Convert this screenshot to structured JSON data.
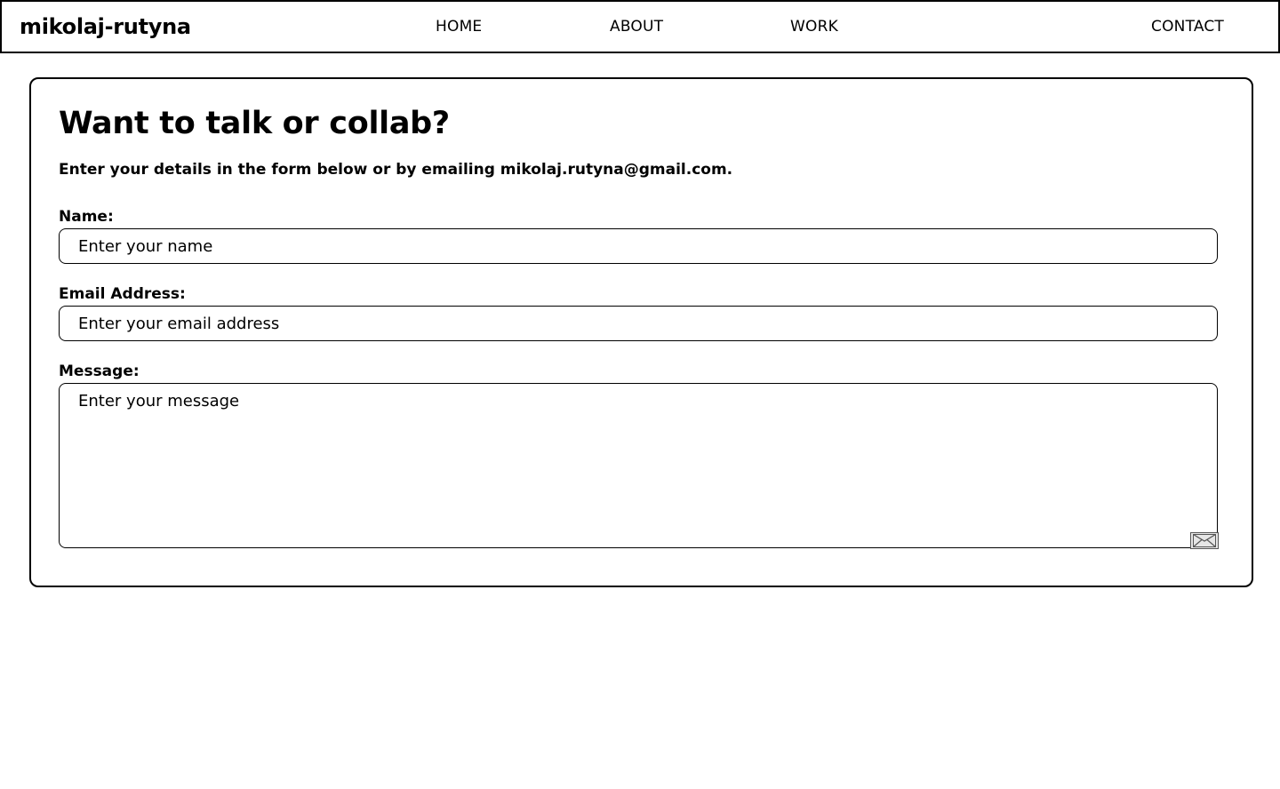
{
  "header": {
    "brand": "mikolaj-rutyna",
    "nav": {
      "home": "HOME",
      "about": "ABOUT",
      "work": "WORK",
      "contact": "CONTACT"
    }
  },
  "contact_form": {
    "title": "Want to talk or collab?",
    "subtitle": "Enter your details in the form below or by emailing mikolaj.rutyna@gmail.com.",
    "name": {
      "label": "Name:",
      "placeholder": "Enter your name",
      "value": ""
    },
    "email": {
      "label": "Email Address:",
      "placeholder": "Enter your email address",
      "value": ""
    },
    "message": {
      "label": "Message:",
      "placeholder": "Enter your message",
      "value": ""
    },
    "send_icon": "envelope-icon"
  },
  "colors": {
    "border": "#000000",
    "background": "#ffffff",
    "icon_fill": "#e6e6e6",
    "icon_stroke": "#555555"
  }
}
